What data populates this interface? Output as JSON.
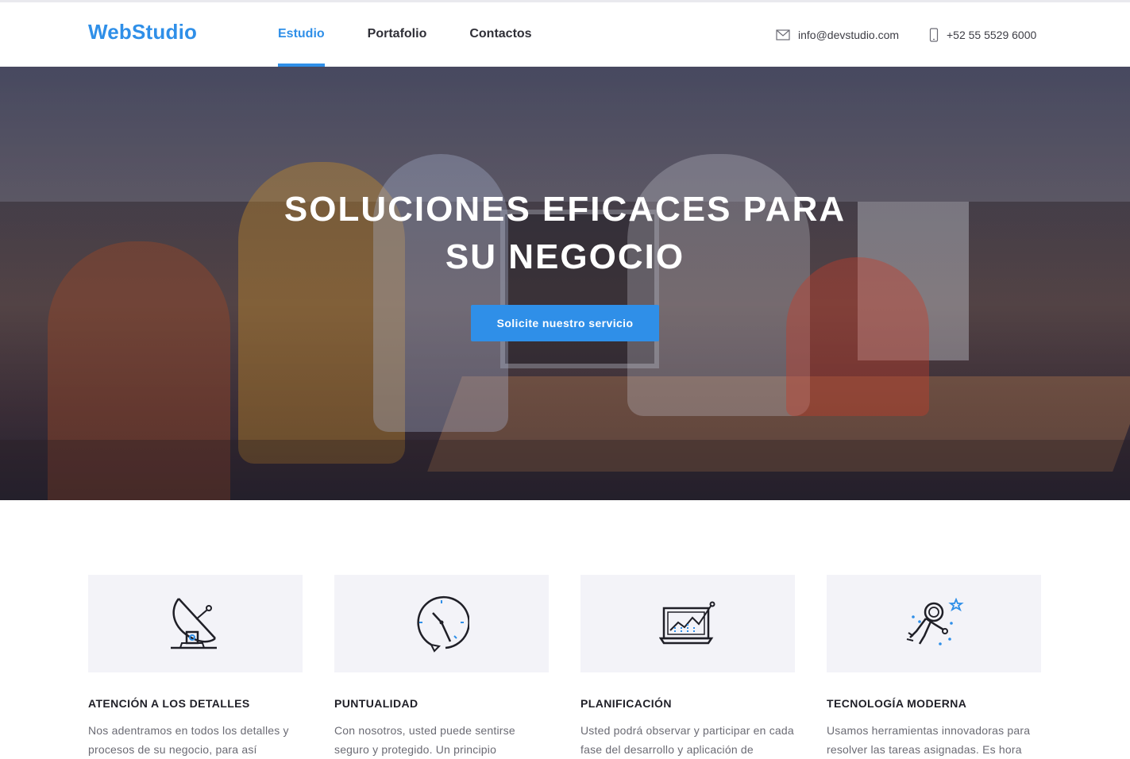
{
  "header": {
    "logo": "WebStudio",
    "nav": [
      {
        "label": "Estudio",
        "active": true
      },
      {
        "label": "Portafolio",
        "active": false
      },
      {
        "label": "Contactos",
        "active": false
      }
    ],
    "email": "info@devstudio.com",
    "phone": "+52 55 5529 6000"
  },
  "hero": {
    "title_line1": "SOLUCIONES EFICACES PARA",
    "title_line2": "SU NEGOCIO",
    "cta": "Solicite nuestro servicio"
  },
  "features": [
    {
      "icon": "satellite-dish-icon",
      "title": "ATENCIÓN A LOS DETALLES",
      "text": "Nos adentramos en todos los detalles y procesos de su negocio, para así"
    },
    {
      "icon": "clock-icon",
      "title": "PUNTUALIDAD",
      "text": "Con nosotros, usted puede sentirse seguro y protegido. Un principio"
    },
    {
      "icon": "laptop-chart-icon",
      "title": "PLANIFICACIÓN",
      "text": "Usted podrá observar y participar en cada fase del desarrollo y aplicación de"
    },
    {
      "icon": "astronaut-icon",
      "title": "TECNOLOGÍA MODERNA",
      "text": "Usamos herramientas innovadoras para resolver las tareas asignadas. Es hora"
    }
  ],
  "colors": {
    "accent": "#2f8fe8",
    "icon_box": "#f3f3f8",
    "text_dark": "#1f1f27",
    "text_muted": "#6b6b74"
  }
}
